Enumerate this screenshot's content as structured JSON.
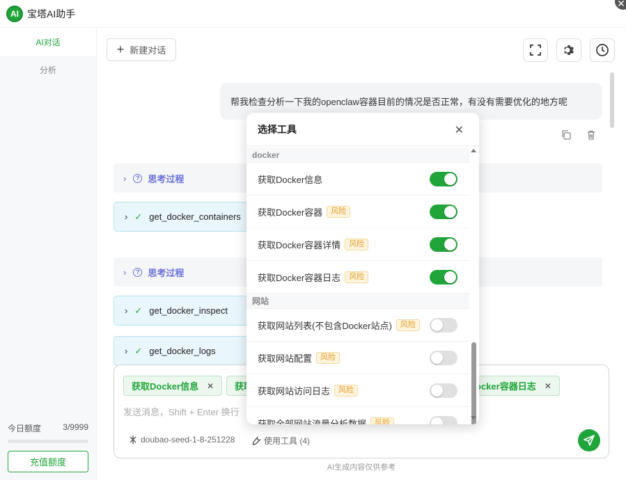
{
  "app": {
    "logo_text": "AI",
    "title": "宝塔AI助手"
  },
  "sidebar": {
    "items": [
      {
        "label": "AI对话",
        "active": true
      },
      {
        "label": "分析",
        "active": false
      }
    ],
    "quota": {
      "label": "今日额度",
      "value": "3/9999",
      "fraction": 0.0003
    },
    "recharge_label": "充值额度"
  },
  "toolbar": {
    "new_chat_label": "新建对话",
    "icons": [
      "fullscreen-icon",
      "gear-icon",
      "history-icon"
    ]
  },
  "chat": {
    "user_message": "帮我检查分析一下我的openclaw容器目前的情况是否正常，有没有需要优化的地方呢",
    "thinking_label": "思考过程",
    "tool_calls": [
      "get_docker_containers",
      "get_docker_inspect",
      "get_docker_logs"
    ]
  },
  "input": {
    "chips": [
      "获取Docker信息",
      "获取",
      "ocker容器日志"
    ],
    "placeholder": "发送消息，Shift + Enter 换行",
    "model": "doubao-seed-1-8-251228",
    "use_tools_label": "使用工具 (4)",
    "footer_note": "AI生成内容仅供参考"
  },
  "popup": {
    "title": "选择工具",
    "groups": [
      {
        "name": "docker",
        "tools": [
          {
            "label": "获取Docker信息",
            "risk": "",
            "enabled": true
          },
          {
            "label": "获取Docker容器",
            "risk": "风险",
            "enabled": true
          },
          {
            "label": "获取Docker容器详情",
            "risk": "风险",
            "enabled": true
          },
          {
            "label": "获取Docker容器日志",
            "risk": "风险",
            "enabled": true
          }
        ]
      },
      {
        "name": "网站",
        "tools": [
          {
            "label": "获取网站列表(不包含Docker站点)",
            "risk": "风险",
            "enabled": false
          },
          {
            "label": "获取网站配置",
            "risk": "风险",
            "enabled": false
          },
          {
            "label": "获取网站访问日志",
            "risk": "风险",
            "enabled": false
          },
          {
            "label": "获取全部网站流量分析数据",
            "risk": "风险",
            "enabled": false
          }
        ]
      }
    ]
  },
  "colors": {
    "accent": "#20a53a",
    "think": "#6b73d8",
    "risk": "#e39b24"
  }
}
